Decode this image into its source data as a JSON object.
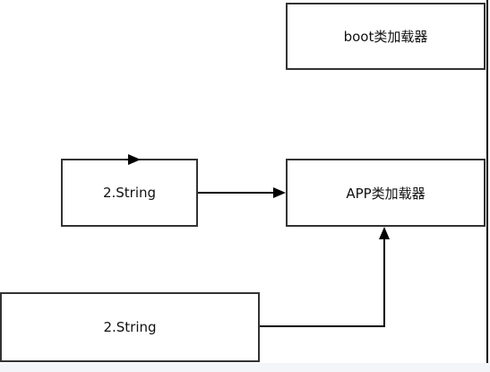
{
  "nodes": {
    "boot": {
      "label": "boot类加载器"
    },
    "app": {
      "label": "APP类加载器"
    },
    "string_top": {
      "label": "2.String"
    },
    "string_bottom": {
      "label": "2.String"
    }
  },
  "colors": {
    "stroke": "#333333",
    "edge": "#000000",
    "background": "#ffffff",
    "strip": "#f3f5f8"
  }
}
